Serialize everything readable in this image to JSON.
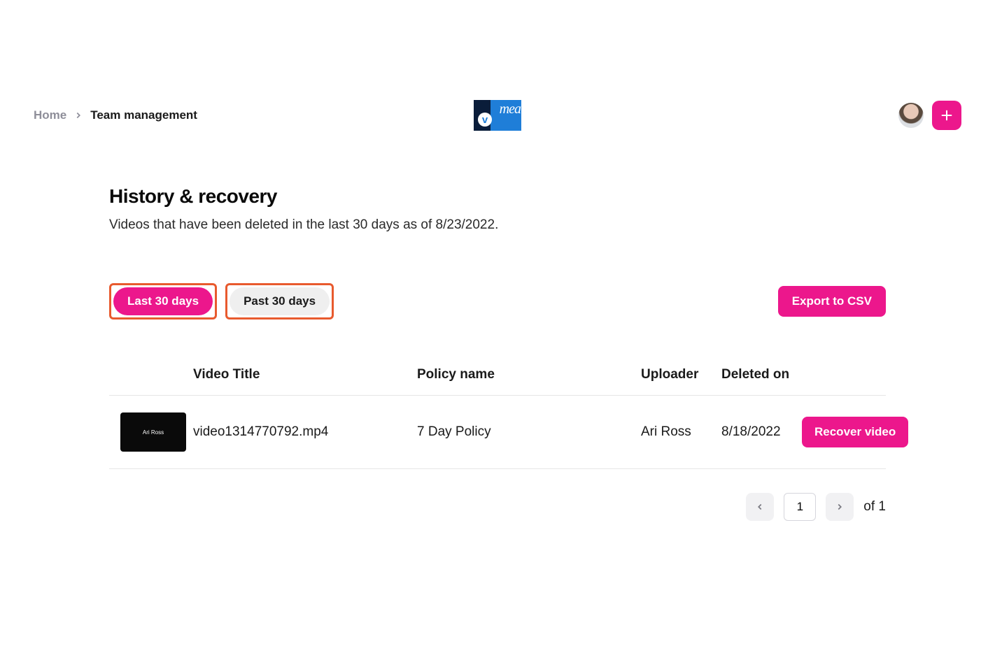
{
  "breadcrumb": {
    "home": "Home",
    "current": "Team management"
  },
  "logo": {
    "badge_letter": "v",
    "script_text": "mea"
  },
  "header_actions": {
    "add_label": "Add"
  },
  "page": {
    "title": "History & recovery",
    "subtitle": "Videos that have been deleted in the last 30 days as of 8/23/2022."
  },
  "filters": {
    "active": "Last 30 days",
    "inactive": "Past 30 days",
    "export": "Export to CSV"
  },
  "table": {
    "columns": {
      "title": "Video Title",
      "policy": "Policy name",
      "uploader": "Uploader",
      "deleted": "Deleted on"
    },
    "rows": [
      {
        "thumb_text": "Ari Ross",
        "title": "video1314770792.mp4",
        "policy": "7 Day Policy",
        "uploader": "Ari Ross",
        "deleted": "8/18/2022",
        "action": "Recover video"
      }
    ]
  },
  "pagination": {
    "current": "1",
    "total_text": "of 1"
  },
  "colors": {
    "accent": "#ec178c",
    "highlight": "#e85a2e"
  }
}
